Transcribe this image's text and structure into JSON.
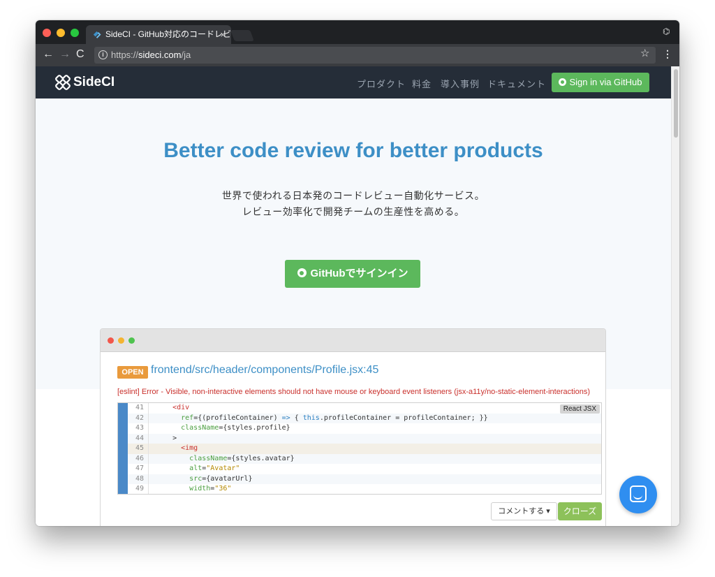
{
  "browser": {
    "tab_title": "SideCI - GitHub対応のコードレビ",
    "tab_close": "×",
    "url_scheme": "https://",
    "url_host": "sideci.com",
    "url_path": "/ja",
    "back_icon": "←",
    "forward_icon": "→",
    "reload_icon": "C",
    "star_icon": "☆",
    "menu_icon": "⋮",
    "incognito_icon": "⌬"
  },
  "site_nav": {
    "logo_text": "SideCI",
    "links": [
      "プロダクト",
      "料金",
      "導入事例",
      "ドキュメント"
    ],
    "signin_label": "Sign in via GitHub"
  },
  "hero": {
    "title": "Better code review for better products",
    "subtitle_line1": "世界で使われる日本発のコードレビュー自動化サービス。",
    "subtitle_line2": "レビュー効率化で開発チームの生産性を高める。",
    "cta_label": "GitHubでサインイン"
  },
  "review_mock": {
    "badge": "OPEN",
    "file_path": "frontend/src/header/components/Profile.jsx:45",
    "lint_message": "[eslint] Error - Visible, non-interactive elements should not have mouse or keyboard event listeners (jsx-a11y/no-static-element-interactions)",
    "language_badge": "React JSX",
    "code_lines": [
      {
        "num": "41",
        "text": "    <div"
      },
      {
        "num": "42",
        "text": "      ref={(profileContainer) => { this.profileContainer = profileContainer; }}"
      },
      {
        "num": "43",
        "text": "      className={styles.profile}"
      },
      {
        "num": "44",
        "text": "    >"
      },
      {
        "num": "45",
        "text": "      <img"
      },
      {
        "num": "46",
        "text": "        className={styles.avatar}"
      },
      {
        "num": "47",
        "text": "        alt=\"Avatar\""
      },
      {
        "num": "48",
        "text": "        src={avatarUrl}"
      },
      {
        "num": "49",
        "text": "        width=\"36\""
      }
    ],
    "comment_button": "コメントする ▾",
    "close_button": "クローズ"
  },
  "colors": {
    "accent_blue": "#3d8fc6",
    "github_green": "#5cb85c",
    "nav_dark": "#252d38"
  }
}
